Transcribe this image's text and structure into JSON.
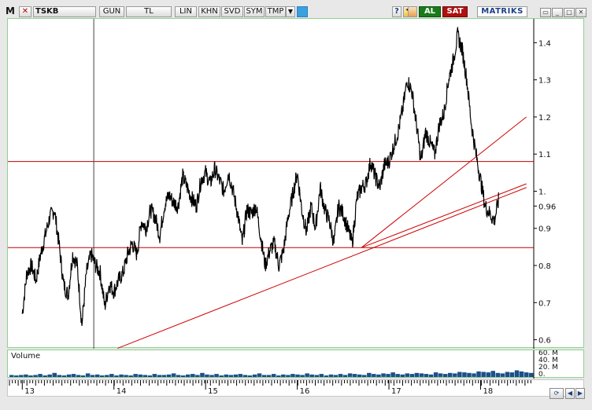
{
  "toolbar": {
    "m_label": "M",
    "close_glyph": "✕",
    "symbol": "TSKB",
    "period": "GUN",
    "currency": "TL",
    "scale": "LIN",
    "buttons": [
      "KHN",
      "SVD",
      "SYM",
      "TMP"
    ],
    "dropdown_glyph": "▼",
    "help_glyph": "?",
    "refresh_glyph": "⟲",
    "buy_label": "AL",
    "sell_label": "SAT",
    "logo": "MATRIKS",
    "window_buttons": [
      "▭",
      "_",
      "□",
      "✕"
    ],
    "colors": {
      "buy": "#1a7a1a",
      "sell": "#b01010",
      "logo": "#1c3f8a"
    }
  },
  "chart_data": {
    "type": "line",
    "y_ticks": [
      "1.4",
      "1.3",
      "1.2",
      "1.1",
      "1.",
      "0.96",
      "0.9",
      "0.8",
      "0.7",
      "0.6"
    ],
    "ylim": [
      0.58,
      1.46
    ],
    "x_ticks": [
      "13",
      "14",
      "15",
      "16",
      "17",
      "18"
    ],
    "x": [
      2013.0,
      2013.05,
      2013.1,
      2013.15,
      2013.2,
      2013.25,
      2013.3,
      2013.35,
      2013.4,
      2013.45,
      2013.5,
      2013.55,
      2013.6,
      2013.65,
      2013.7,
      2013.75,
      2013.8,
      2013.85,
      2013.9,
      2013.95,
      2014.0,
      2014.05,
      2014.1,
      2014.15,
      2014.2,
      2014.25,
      2014.3,
      2014.35,
      2014.4,
      2014.45,
      2014.5,
      2014.55,
      2014.6,
      2014.65,
      2014.7,
      2014.75,
      2014.8,
      2014.85,
      2014.9,
      2014.95,
      2015.0,
      2015.05,
      2015.1,
      2015.15,
      2015.2,
      2015.25,
      2015.3,
      2015.35,
      2015.4,
      2015.45,
      2015.5,
      2015.55,
      2015.6,
      2015.65,
      2015.7,
      2015.75,
      2015.8,
      2015.85,
      2015.9,
      2015.95,
      2016.0,
      2016.05,
      2016.1,
      2016.15,
      2016.2,
      2016.25,
      2016.3,
      2016.35,
      2016.4,
      2016.45,
      2016.5,
      2016.55,
      2016.6,
      2016.65,
      2016.7,
      2016.75,
      2016.8,
      2016.85,
      2016.9,
      2016.95,
      2017.0,
      2017.05,
      2017.1,
      2017.15,
      2017.2,
      2017.25,
      2017.3,
      2017.35,
      2017.4,
      2017.45,
      2017.5,
      2017.55,
      2017.6,
      2017.65,
      2017.7,
      2017.75,
      2017.8,
      2017.85,
      2017.9,
      2017.95,
      2018.0,
      2018.05,
      2018.1,
      2018.15,
      2018.2,
      2018.25,
      2018.3,
      2018.35,
      2018.4,
      2018.45,
      2018.5
    ],
    "price": [
      0.67,
      0.78,
      0.8,
      0.76,
      0.83,
      0.88,
      0.93,
      0.95,
      0.86,
      0.75,
      0.72,
      0.83,
      0.8,
      0.64,
      0.78,
      0.83,
      0.8,
      0.78,
      0.69,
      0.75,
      0.73,
      0.76,
      0.78,
      0.83,
      0.86,
      0.83,
      0.92,
      0.9,
      0.95,
      0.93,
      0.88,
      0.96,
      0.99,
      0.97,
      0.96,
      1.04,
      1.01,
      0.98,
      0.96,
      1.03,
      1.05,
      1.02,
      1.06,
      1.03,
      1.0,
      1.05,
      1.0,
      0.94,
      0.86,
      0.95,
      0.94,
      0.96,
      0.88,
      0.8,
      0.84,
      0.86,
      0.8,
      0.84,
      0.93,
      0.99,
      1.05,
      0.95,
      0.89,
      0.96,
      0.9,
      1.01,
      0.95,
      0.92,
      0.86,
      0.96,
      0.94,
      0.9,
      0.86,
      0.98,
      1.01,
      1.02,
      1.08,
      1.04,
      1.01,
      1.07,
      1.08,
      1.12,
      1.16,
      1.22,
      1.3,
      1.27,
      1.18,
      1.08,
      1.16,
      1.13,
      1.1,
      1.18,
      1.21,
      1.3,
      1.35,
      1.42,
      1.38,
      1.3,
      1.18,
      1.1,
      1.03,
      0.96,
      0.94,
      0.92,
      0.98
    ],
    "h_lines": [
      1.08,
      0.848
    ],
    "trend_lines": [
      {
        "from": [
          2014.04,
          0.577
        ],
        "to": [
          2018.5,
          1.01
        ]
      },
      {
        "from": [
          2016.7,
          0.848
        ],
        "to": [
          2018.5,
          1.2
        ]
      },
      {
        "from": [
          2016.7,
          0.848
        ],
        "to": [
          2018.5,
          1.02
        ]
      }
    ],
    "vertical_marker_x": 2013.78,
    "colors": {
      "price": "#000000",
      "h_lines": "#c00000",
      "trend_lines": "#d00000",
      "marker": "#444444"
    }
  },
  "volume_data": {
    "title": "Volume",
    "y_ticks": [
      "60. M",
      "40. M",
      "20. M",
      "0."
    ],
    "max": 60,
    "color": "#1c4f8c",
    "values": [
      4,
      3,
      4,
      5,
      3,
      4,
      6,
      3,
      5,
      8,
      4,
      3,
      5,
      6,
      4,
      3,
      7,
      4,
      5,
      3,
      4,
      6,
      3,
      5,
      4,
      3,
      6,
      5,
      4,
      3,
      6,
      4,
      4,
      5,
      7,
      4,
      3,
      5,
      6,
      4,
      8,
      5,
      4,
      6,
      3,
      5,
      4,
      5,
      6,
      4,
      3,
      5,
      7,
      4,
      4,
      6,
      3,
      5,
      4,
      6,
      5,
      4,
      7,
      5,
      4,
      6,
      3,
      5,
      4,
      6,
      4,
      7,
      6,
      5,
      4,
      8,
      6,
      5,
      7,
      6,
      9,
      6,
      5,
      7,
      6,
      8,
      7,
      6,
      5,
      9,
      7,
      6,
      8,
      7,
      10,
      9,
      8,
      7,
      11,
      10,
      9,
      12,
      8,
      7,
      10,
      9,
      13,
      11,
      9,
      8
    ]
  },
  "scroll_controls": [
    "⟳",
    "◀",
    "▶"
  ]
}
